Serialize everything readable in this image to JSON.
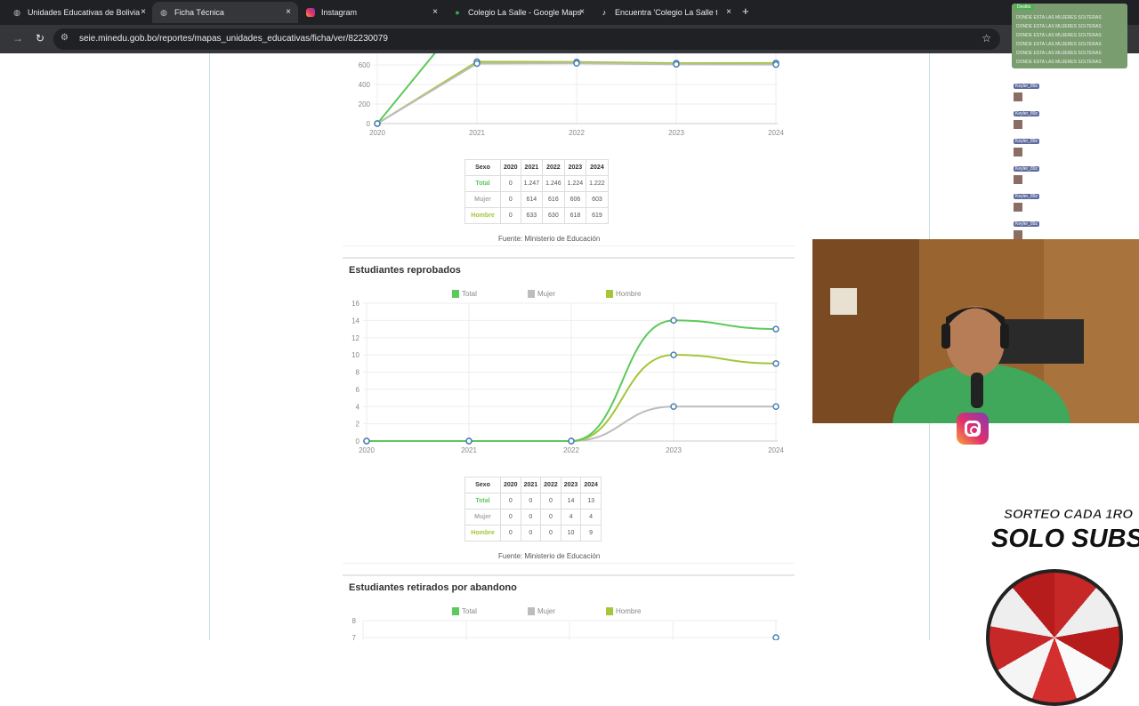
{
  "browser": {
    "tabs": [
      {
        "title": "Unidades Educativas de Bolivia",
        "icon": "globe-icon"
      },
      {
        "title": "Ficha Técnica",
        "icon": "globe-icon"
      },
      {
        "title": "Instagram",
        "icon": "instagram-icon"
      },
      {
        "title": "Colegio La Salle - Google Maps",
        "icon": "maps-icon"
      },
      {
        "title": "Encuentra 'Colegio La Salle trin",
        "icon": "tiktok-icon"
      }
    ],
    "new_tab": "+",
    "close_glyph": "×",
    "url": "seie.minedu.gob.bo/reportes/mapas_unidades_educativas/ficha/ver/82230079"
  },
  "top_chart": {
    "y_ticks": [
      "600",
      "400",
      "200",
      "0"
    ],
    "x_ticks": [
      "2020",
      "2021",
      "2022",
      "2023",
      "2024"
    ],
    "table": {
      "header": [
        "Sexo",
        "2020",
        "2021",
        "2022",
        "2023",
        "2024"
      ],
      "rows": [
        {
          "label": "Total",
          "values": [
            "0",
            "1.247",
            "1.246",
            "1.224",
            "1.222"
          ]
        },
        {
          "label": "Mujer",
          "values": [
            "0",
            "614",
            "616",
            "606",
            "603"
          ]
        },
        {
          "label": "Hombre",
          "values": [
            "0",
            "633",
            "630",
            "618",
            "619"
          ]
        }
      ]
    },
    "source": "Fuente: Ministerio de Educación"
  },
  "reprobados": {
    "title": "Estudiantes reprobados",
    "legend": [
      "Total",
      "Mujer",
      "Hombre"
    ],
    "source": "Fuente: Ministerio de Educación",
    "table": {
      "header": [
        "Sexo",
        "2020",
        "2021",
        "2022",
        "2023",
        "2024"
      ],
      "rows": [
        {
          "label": "Total",
          "values": [
            "0",
            "0",
            "0",
            "14",
            "13"
          ]
        },
        {
          "label": "Mujer",
          "values": [
            "0",
            "0",
            "0",
            "4",
            "4"
          ]
        },
        {
          "label": "Hombre",
          "values": [
            "0",
            "0",
            "0",
            "10",
            "9"
          ]
        }
      ]
    }
  },
  "abandono": {
    "title": "Estudiantes retirados por abandono",
    "legend": [
      "Total",
      "Mujer",
      "Hombre"
    ],
    "y_ticks": [
      "8",
      "7"
    ]
  },
  "colors": {
    "total": "#5cc95c",
    "mujer": "#bdbdbd",
    "hombre": "#a4c639",
    "point": "#4a7fb0"
  },
  "chart_data": [
    {
      "type": "line",
      "title": "",
      "x": [
        "2020",
        "2021",
        "2022",
        "2023",
        "2024"
      ],
      "ylim": [
        0,
        600
      ],
      "series": [
        {
          "name": "Total",
          "values": [
            0,
            1247,
            1246,
            1224,
            1222
          ]
        },
        {
          "name": "Mujer",
          "values": [
            0,
            614,
            616,
            606,
            603
          ]
        },
        {
          "name": "Hombre",
          "values": [
            0,
            633,
            630,
            618,
            619
          ]
        }
      ]
    },
    {
      "type": "line",
      "title": "Estudiantes reprobados",
      "x": [
        "2020",
        "2021",
        "2022",
        "2023",
        "2024"
      ],
      "ylim": [
        0,
        16
      ],
      "y_ticks": [
        "0",
        "2",
        "4",
        "6",
        "8",
        "10",
        "12",
        "14",
        "16"
      ],
      "grid": true,
      "legend_position": "top",
      "series": [
        {
          "name": "Total",
          "values": [
            0,
            0,
            0,
            14,
            13
          ]
        },
        {
          "name": "Mujer",
          "values": [
            0,
            0,
            0,
            4,
            4
          ]
        },
        {
          "name": "Hombre",
          "values": [
            0,
            0,
            0,
            10,
            9
          ]
        }
      ]
    }
  ],
  "overlay": {
    "chat_header": "Destito",
    "chat_lines": [
      "DONDE ESTA LAS MUJERES SOLTERAS",
      "DONDE ESTA LAS MUJERES SOLTERAS",
      "DONDE ESTA LAS MUJERES SOLTERAS",
      "DONDE ESTA LAS MUJERES SOLTERAS",
      "DONDE ESTA LAS MUJERES SOLTERAS",
      "DONDE ESTA LAS MUJERES SOLTERAS"
    ],
    "chat_user": "Keyler_89z",
    "promo_line1": "SORTEO CADA 1RO",
    "promo_line2": "SOLO SUBS"
  }
}
